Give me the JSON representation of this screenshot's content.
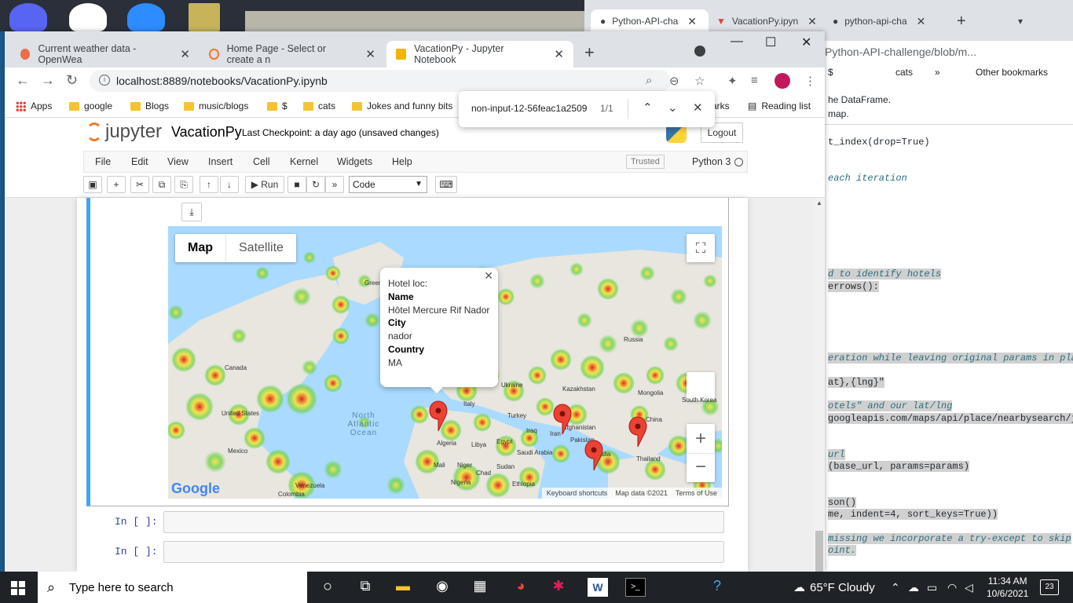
{
  "github_window": {
    "tabs": [
      {
        "title": "Python-API-cha"
      },
      {
        "title": "VacationPy.ipyn"
      },
      {
        "title": "python-api-cha"
      }
    ],
    "address": "Python-API-challenge/blob/m...",
    "bookmarks": [
      "$",
      "cats",
      "»",
      "Other bookmarks"
    ],
    "code_lines": [
      {
        "text": "he DataFrame.",
        "style": "plain"
      },
      {
        "text": "map.",
        "style": "plain"
      },
      {
        "text": "t_index(drop=True)",
        "style": "code"
      },
      {
        "text": " each iteration",
        "style": "comment"
      },
      {
        "text": "d to identify hotels",
        "style": "comment-hl"
      },
      {
        "text": "errows():",
        "style": "code-hl"
      },
      {
        "text": "eration while leaving original params in pla",
        "style": "comment-hl"
      },
      {
        "text": "at},{lng}\"",
        "style": "code-hl"
      },
      {
        "text": "otels\" and our lat/lng",
        "style": "comment-hl"
      },
      {
        "text": "googleapis.com/maps/api/place/nearbysearch/j",
        "style": "code-hl"
      },
      {
        "text": "url",
        "style": "comment-hl"
      },
      {
        "text": "(base_url, params=params)",
        "style": "code-hl"
      },
      {
        "text": "son()",
        "style": "code-hl"
      },
      {
        "text": "me, indent=4, sort_keys=True))",
        "style": "code-hl"
      },
      {
        "text": "missing we incorporate a try-except to skip",
        "style": "comment-hl"
      },
      {
        "text": "oint.",
        "style": "comment-hl"
      }
    ]
  },
  "browser": {
    "tabs": [
      {
        "title": "Current weather data - OpenWea",
        "favicon_color": "#eb6e4b"
      },
      {
        "title": "Home Page - Select or create a n",
        "favicon_color": "#f37726"
      },
      {
        "title": "VacationPy - Jupyter Notebook",
        "favicon_color": "#f4b400"
      }
    ],
    "url": "localhost:8889/notebooks/VacationPy.ipynb",
    "bookmarks": [
      {
        "label": "Apps",
        "type": "apps"
      },
      {
        "label": "google",
        "type": "folder"
      },
      {
        "label": "Blogs",
        "type": "folder"
      },
      {
        "label": "music/blogs",
        "type": "folder"
      },
      {
        "label": "$",
        "type": "folder"
      },
      {
        "label": "cats",
        "type": "folder"
      },
      {
        "label": "Jokes and funny bits",
        "type": "folder"
      },
      {
        "label": "arks",
        "type": "text"
      },
      {
        "label": "Reading list",
        "type": "reading"
      }
    ],
    "find": {
      "query": "non-input-12-56feac1a2509",
      "count": "1/1"
    }
  },
  "jupyter": {
    "logo_text": "jupyter",
    "notebook_name": "VacationPy",
    "checkpoint": "Last Checkpoint: a day ago  (unsaved changes)",
    "logout": "Logout",
    "menu": [
      "File",
      "Edit",
      "View",
      "Insert",
      "Cell",
      "Kernel",
      "Widgets",
      "Help"
    ],
    "trusted": "Trusted",
    "kernel": "Python 3",
    "run_label": "Run",
    "cell_type": "Code",
    "prompts": [
      "In [ ]:",
      "In [ ]:"
    ]
  },
  "map": {
    "map_type_active": "Map",
    "map_type_inactive": "Satellite",
    "infowindow": {
      "line1": "Hotel loc:",
      "name_label": "Name",
      "name": "Hôtel Mercure Rif Nador",
      "city_label": "City",
      "city": "nador",
      "country_label": "Country",
      "country": "MA"
    },
    "labels": {
      "greenland": "Greenland",
      "russia": "Russia",
      "canada": "Canada",
      "united_states": "United States",
      "mexico": "Mexico",
      "north_atlantic": "North Atlantic Ocean",
      "ukraine": "Ukraine",
      "kazakhstan": "Kazakhstan",
      "mongolia": "Mongolia",
      "turkey": "Turkey",
      "iraq": "Iraq",
      "iran": "Iran",
      "afghanistan": "Afghanistan",
      "pakistan": "Pakistan",
      "india": "India",
      "china": "China",
      "thailand": "Thailand",
      "algeria": "Algeria",
      "libya": "Libya",
      "egypt": "Egypt",
      "saudi_arabia": "Saudi Arabia",
      "mali": "Mali",
      "niger": "Niger",
      "chad": "Chad",
      "sudan": "Sudan",
      "nigeria": "Nigeria",
      "ethiopia": "Ethiopia",
      "venezuela": "Venezuela",
      "colombia": "Colombia",
      "italy": "Italy",
      "south_korea": "South Korea"
    },
    "google": "Google",
    "attribution": [
      "Keyboard shortcuts",
      "Map data ©2021",
      "Terms of Use"
    ]
  },
  "taskbar": {
    "search_placeholder": "Type here to search",
    "weather": "65°F  Cloudy",
    "time": "11:34 AM",
    "date": "10/6/2021",
    "notifications": "23"
  },
  "colors": {
    "heat_red": "#e02020",
    "heat_yellow": "#f5e43a",
    "heat_green": "#6fd24b",
    "land": "#e8e6df",
    "water": "#aadaff",
    "marker": "#ea4335"
  }
}
